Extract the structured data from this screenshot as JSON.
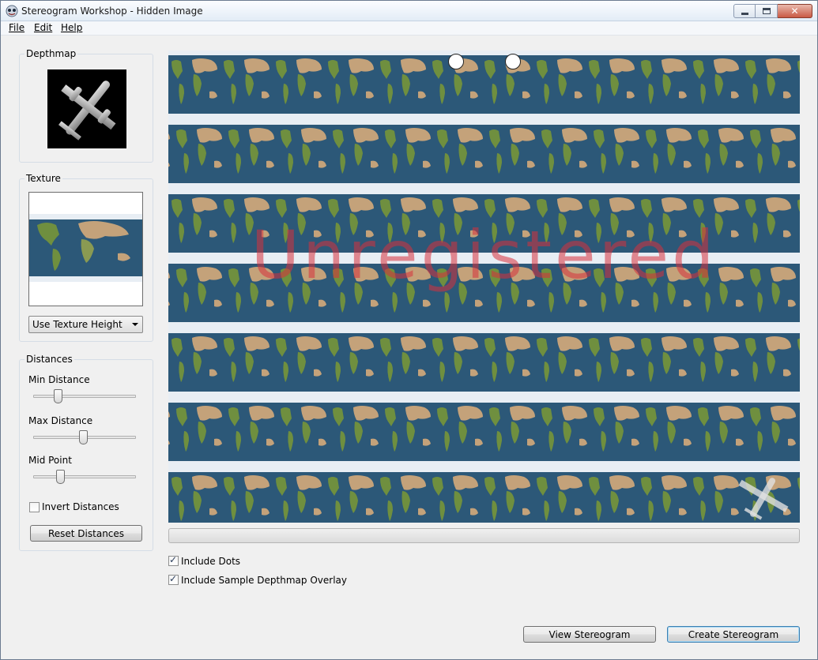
{
  "window": {
    "title": "Stereogram Workshop - Hidden Image",
    "close_glyph": "✕"
  },
  "menu": [
    {
      "label": "File"
    },
    {
      "label": "Edit"
    },
    {
      "label": "Help"
    }
  ],
  "depthmap": {
    "label": "Depthmap"
  },
  "texture": {
    "label": "Texture",
    "height_mode": "Use Texture Height"
  },
  "distances": {
    "label": "Distances",
    "min": {
      "label": "Min Distance",
      "value": 0.25
    },
    "max": {
      "label": "Max Distance",
      "value": 0.5
    },
    "mid": {
      "label": "Mid Point",
      "value": 0.27
    },
    "invert": {
      "label": "Invert Distances",
      "checked": false
    },
    "reset_label": "Reset Distances"
  },
  "preview": {
    "watermark": "Unregistered",
    "progress": 0
  },
  "options": {
    "include_dots": {
      "label": "Include Dots",
      "checked": true
    },
    "include_overlay": {
      "label": "Include Sample Depthmap Overlay",
      "checked": true
    }
  },
  "actions": {
    "view_label": "View Stereogram",
    "create_label": "Create Stereogram"
  },
  "icons": {
    "app": "stereogram-app-icon",
    "minimize": "minimize-icon",
    "maximize": "maximize-icon",
    "close": "close-icon",
    "dropdown": "chevron-down-icon",
    "check": "checkmark-icon"
  },
  "colors": {
    "ocean": "#2c5878",
    "land": "#6f8f3f",
    "desert": "#c4a27a",
    "ice": "#e8eef4",
    "watermark": "#d7323c"
  }
}
